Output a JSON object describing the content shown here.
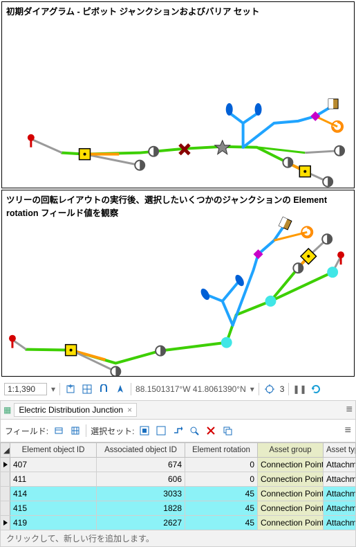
{
  "panel1": {
    "title": "初期ダイアグラム - ピボット ジャンクションおよびバリア セット"
  },
  "panel2": {
    "title": "ツリーの回転レイアウトの実行後、選択したいくつかのジャンクションの Element rotation フィールド値を観察"
  },
  "toolbar": {
    "scale": "1:1,390",
    "dropdown_glyph": "▾",
    "coords": "88.1501317°W 41.8061390°N",
    "sel_count": "3"
  },
  "tabs": {
    "table_icon": "▦",
    "active": "Electric Distribution Junction",
    "close": "×",
    "menu": "≡"
  },
  "fieldbar": {
    "field_label": "フィールド:",
    "sel_label": "選択セット:",
    "menu": "≡"
  },
  "table": {
    "headers": {
      "eoid": "Element object ID",
      "aoid": "Associated object ID",
      "erot": "Element rotation",
      "agroup": "Asset group",
      "atype": "Asset type"
    },
    "rows": [
      {
        "eoid": "407",
        "aoid": "674",
        "erot": "0",
        "agroup": "Connection Point",
        "atype": "Attachment",
        "hilite": false,
        "tri": true
      },
      {
        "eoid": "411",
        "aoid": "606",
        "erot": "0",
        "agroup": "Connection Point",
        "atype": "Attachment",
        "hilite": false,
        "tri": false
      },
      {
        "eoid": "414",
        "aoid": "3033",
        "erot": "45",
        "agroup": "Connection Point",
        "atype": "Attachment",
        "hilite": true,
        "tri": false
      },
      {
        "eoid": "415",
        "aoid": "1828",
        "erot": "45",
        "agroup": "Connection Point",
        "atype": "Attachment",
        "hilite": true,
        "tri": false
      },
      {
        "eoid": "419",
        "aoid": "2627",
        "erot": "45",
        "agroup": "Connection Point",
        "atype": "Attachment",
        "hilite": true,
        "tri": true
      }
    ],
    "footer": "クリックして、新しい行を追加します。"
  }
}
